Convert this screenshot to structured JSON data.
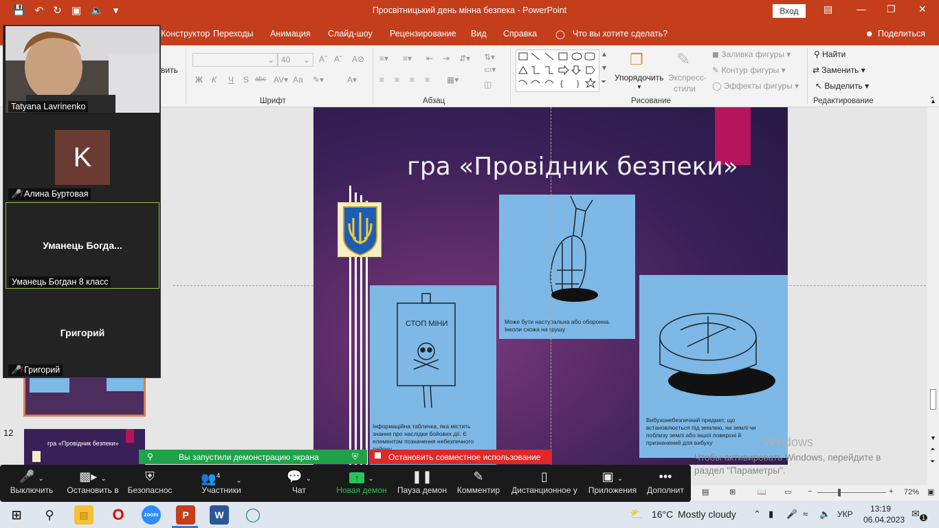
{
  "window": {
    "title": "Просвітницький день мінна безпека  -  PowerPoint",
    "signin": "Вход"
  },
  "menu": {
    "tabs": [
      "Конструктор",
      "Переходы",
      "Анимация",
      "Слайд-шоу",
      "Рецензирование",
      "Вид",
      "Справка"
    ],
    "tell_me": "Что вы хотите сделать?",
    "share": "Поделиться"
  },
  "ribbon": {
    "paste_partial": "вить",
    "font_size": "40",
    "groups": {
      "font": "Шрифт",
      "paragraph": "Абзац",
      "drawing": "Рисование",
      "editing": "Редактирование"
    },
    "arrange": "Упорядочить",
    "quick_styles_1": "Экспресс-",
    "quick_styles_2": "стили",
    "shape_fill": "Заливка фигуры",
    "shape_outline": "Контур фигуры",
    "shape_effects": "Эффекты фигуры",
    "find": "Найти",
    "replace": "Заменить",
    "select": "Выделить",
    "bold": "Ж",
    "italic": "К",
    "underline": "Ч",
    "strike": "S",
    "abc": "abc",
    "aa": "Аа"
  },
  "slide": {
    "title": "гра «Провідник безпеки»",
    "sign_text": "СТОП МІНИ",
    "card1_text": "Інформаційна табличка, яка містить знання про наслідки бойових дії. Є елементом позначення небезпечного району",
    "card2_text": "Може бути наступальна або оборонна. Інколи схожа на грушу",
    "card3_text": "Вибухонебезпечний предмет, що встановлюється під землею, на землі чи поблизу землі або іншої поверхні й призначений для вибуху"
  },
  "thumbnails": {
    "slide_number": "12",
    "slide_title": "гра «Провідник безпеки»"
  },
  "participants": [
    {
      "name": "Tatyana Lavrinenko",
      "muted": false
    },
    {
      "name": "Алина Буртовая",
      "initial": "K",
      "muted": true
    },
    {
      "name": "Уманець Богдан 8 класс",
      "display": "Уманець  Богда...",
      "muted": false
    },
    {
      "name": "Григорий",
      "display": "Григорий",
      "muted": true
    }
  ],
  "sharing": {
    "notice": "Вы запустили демонстрацию экрана",
    "stop": "Остановить совместное использование"
  },
  "zoom_toolbar": {
    "mute": "Выключить",
    "stop_video": "Остановить в",
    "security": "Безопаснос",
    "participants": "Участники",
    "participants_count": "4",
    "chat": "Чат",
    "new_share": "Новая демон",
    "pause_share": "Пауза демон",
    "annotate": "Комментир",
    "remote": "Дистанционное у",
    "apps": "Приложения",
    "more": "Дополнит"
  },
  "statusbar": {
    "zoom": "72%"
  },
  "watermark": {
    "line1": "Windows",
    "line2": "Чтобы активировать Windows, перейдите в",
    "line3": "раздел \"Параметры\"."
  },
  "taskbar": {
    "weather_temp": "16°C",
    "weather_desc": "Mostly cloudy",
    "lang": "УКР",
    "time": "13:19",
    "date": "06.04.2023",
    "notifications": "1",
    "zoom_label": "zoom"
  },
  "colors": {
    "accent": "#c43e1c",
    "slide_card": "#7db8e6",
    "slide_pink": "#b5155d",
    "share_green": "#1fa34a",
    "share_red": "#e02828"
  }
}
